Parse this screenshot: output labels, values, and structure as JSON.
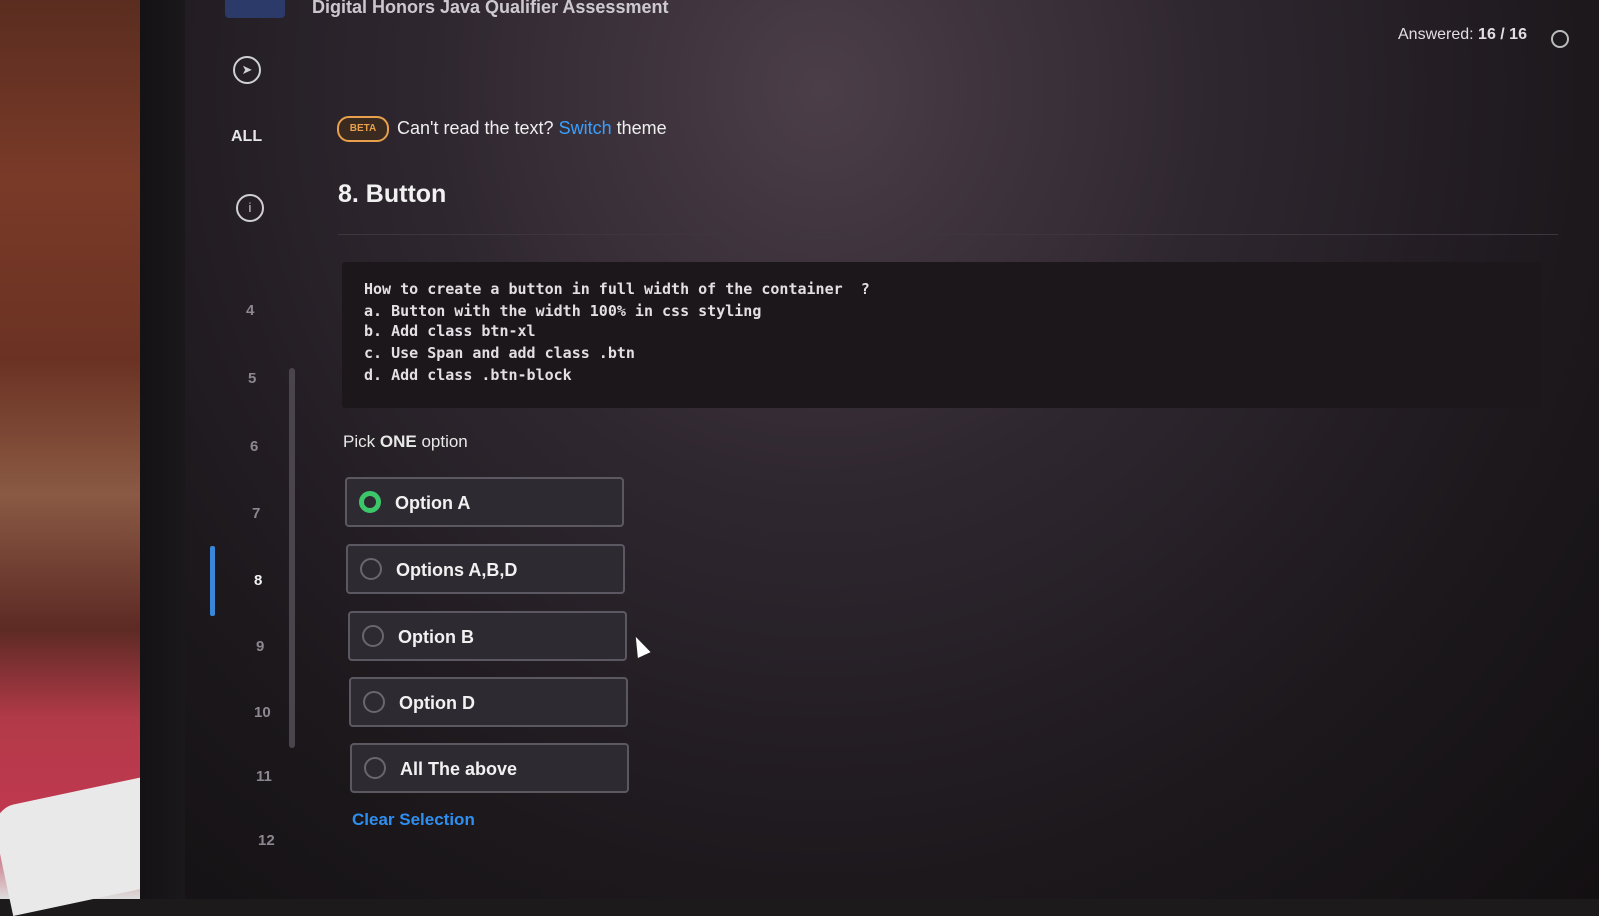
{
  "header": {
    "title": "Digital Honors Java Qualifier Assessment",
    "answered_label": "Answered:",
    "answered_value": "16 / 16"
  },
  "sidenav": {
    "all_label": "ALL",
    "numbers": [
      "4",
      "5",
      "6",
      "7",
      "8",
      "9",
      "10",
      "11",
      "12"
    ],
    "active": "8"
  },
  "theme_notice": {
    "badge": "BETA",
    "text": "Can't read the text?",
    "link": "Switch",
    "suffix": "theme"
  },
  "question": {
    "title": "8. Button",
    "code_lines": [
      "How to create a button in full width of the container  ?",
      "a. Button with the width 100% in css styling",
      "b. Add class btn-xl",
      "c. Use Span and add class .btn",
      "d. Add class .btn-block"
    ],
    "pick_prefix": "Pick",
    "pick_bold": "ONE",
    "pick_suffix": "option"
  },
  "options": [
    {
      "label": "Option A",
      "selected": true
    },
    {
      "label": "Options A,B,D",
      "selected": false
    },
    {
      "label": "Option B",
      "selected": false
    },
    {
      "label": "Option D",
      "selected": false
    },
    {
      "label": "All The above",
      "selected": false
    }
  ],
  "clear_label": "Clear Selection",
  "colors": {
    "accent": "#3aa0ff",
    "selected_radio": "#3cc76a",
    "beta_badge": "#e8a04c"
  }
}
